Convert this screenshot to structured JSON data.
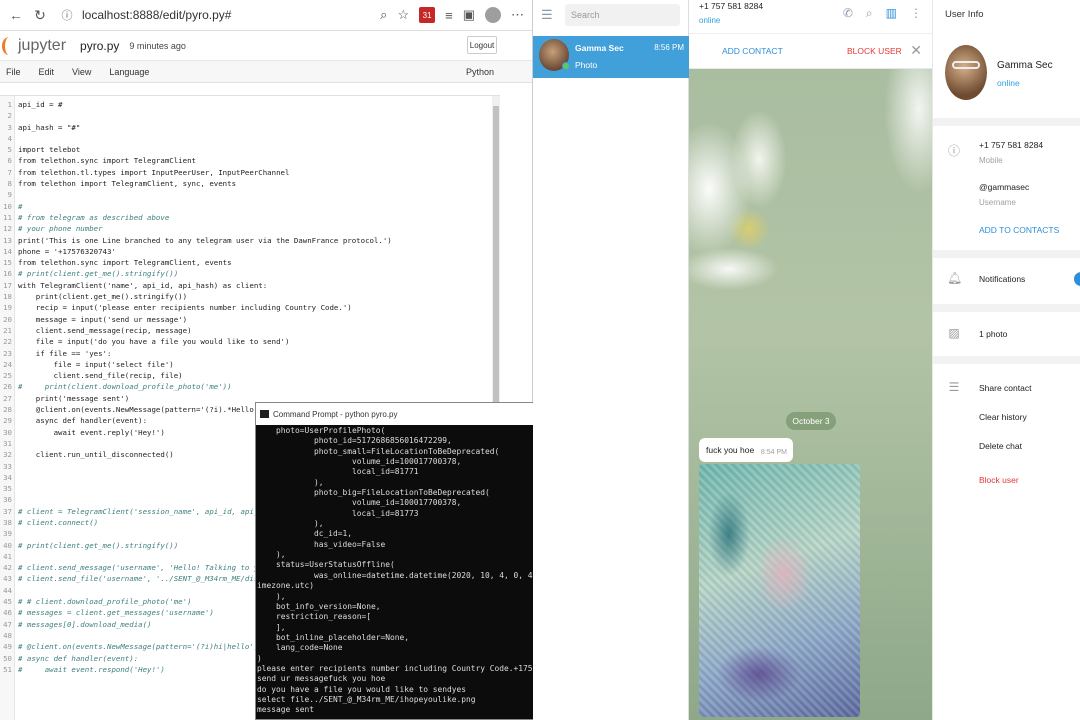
{
  "browser": {
    "url": "localhost:8888/edit/pyro.py#",
    "extension_badge": "31"
  },
  "jupyter": {
    "logo": "jupyter",
    "filename": "pyro.py",
    "saved": "9 minutes ago",
    "logout": "Logout",
    "menu": [
      "File",
      "Edit",
      "View",
      "Language"
    ],
    "kernel": "Python"
  },
  "code_lines": [
    {
      "n": "1",
      "t": "api_id = #"
    },
    {
      "n": "2",
      "t": ""
    },
    {
      "n": "3",
      "t": "api_hash = \"#\""
    },
    {
      "n": "4",
      "t": ""
    },
    {
      "n": "5",
      "t": "import telebot"
    },
    {
      "n": "6",
      "t": "from telethon.sync import TelegramClient"
    },
    {
      "n": "7",
      "t": "from telethon.tl.types import InputPeerUser, InputPeerChannel"
    },
    {
      "n": "8",
      "t": "from telethon import TelegramClient, sync, events"
    },
    {
      "n": "9",
      "t": ""
    },
    {
      "n": "10",
      "t": "#"
    },
    {
      "n": "11",
      "t": "# from telegram as described above"
    },
    {
      "n": "12",
      "t": "# your phone number"
    },
    {
      "n": "13",
      "t": "print('This is one Line branched to any telegram user via the DawnFrance protocol.')"
    },
    {
      "n": "14",
      "t": "phone = '+17576320743'"
    },
    {
      "n": "15",
      "t": "from telethon.sync import TelegramClient, events"
    },
    {
      "n": "16",
      "t": "# print(client.get_me().stringify())"
    },
    {
      "n": "17",
      "t": "with TelegramClient('name', api_id, api_hash) as client:"
    },
    {
      "n": "18",
      "t": "    print(client.get_me().stringify())"
    },
    {
      "n": "19",
      "t": "    recip = input('please enter recipients number including Country Code.')"
    },
    {
      "n": "20",
      "t": "    message = input('send ur message')"
    },
    {
      "n": "21",
      "t": "    client.send_message(recip, message)"
    },
    {
      "n": "22",
      "t": "    file = input('do you have a file you would like to send')"
    },
    {
      "n": "23",
      "t": "    if file == 'yes':"
    },
    {
      "n": "24",
      "t": "        file = input('select file')"
    },
    {
      "n": "25",
      "t": "        client.send_file(recip, file)"
    },
    {
      "n": "26",
      "t": "#     print(client.download_profile_photo('me'))"
    },
    {
      "n": "27",
      "t": "    print('message sent')"
    },
    {
      "n": "28",
      "t": "    @client.on(events.NewMessage(pattern='(?i).*Hello'))"
    },
    {
      "n": "29",
      "t": "    async def handler(event):"
    },
    {
      "n": "30",
      "t": "        await event.reply('Hey!')"
    },
    {
      "n": "31",
      "t": ""
    },
    {
      "n": "32",
      "t": "    client.run_until_disconnected()"
    },
    {
      "n": "33",
      "t": ""
    },
    {
      "n": "34",
      "t": ""
    },
    {
      "n": "35",
      "t": ""
    },
    {
      "n": "36",
      "t": ""
    },
    {
      "n": "37",
      "t": "# client = TelegramClient('session_name', api_id, api_hash)"
    },
    {
      "n": "38",
      "t": "# client.connect()"
    },
    {
      "n": "39",
      "t": ""
    },
    {
      "n": "40",
      "t": "# print(client.get_me().stringify())"
    },
    {
      "n": "41",
      "t": ""
    },
    {
      "n": "42",
      "t": "# client.send_message('username', 'Hello! Talking to you f"
    },
    {
      "n": "43",
      "t": "# client.send_file('username', '../SENT_@_M34rm_ME/dis2.pn"
    },
    {
      "n": "44",
      "t": ""
    },
    {
      "n": "45",
      "t": "# # client.download_profile_photo('me')"
    },
    {
      "n": "46",
      "t": "# messages = client.get_messages('username')"
    },
    {
      "n": "47",
      "t": "# messages[0].download_media()"
    },
    {
      "n": "48",
      "t": ""
    },
    {
      "n": "49",
      "t": "# @client.on(events.NewMessage(pattern='(?i)hi|hello'))"
    },
    {
      "n": "50",
      "t": "# async def handler(event):"
    },
    {
      "n": "51",
      "t": "#     await event.respond('Hey!')"
    }
  ],
  "cmd": {
    "title": "Command Prompt - python  pyro.py",
    "lines": [
      "    photo=UserProfilePhoto(",
      "            photo_id=5172686856016472299,",
      "            photo_small=FileLocationToBeDeprecated(",
      "                    volume_id=100017700378,",
      "                    local_id=81771",
      "            ),",
      "            photo_big=FileLocationToBeDeprecated(",
      "                    volume_id=100017700378,",
      "                    local_id=81773",
      "            ),",
      "            dc_id=1,",
      "            has_video=False",
      "    ),",
      "    status=UserStatusOffline(",
      "            was_online=datetime.datetime(2020, 10, 4, 0, 47, 27, tzinfo=datetime.t",
      "imezone.utc)",
      "    ),",
      "    bot_info_version=None,",
      "    restriction_reason=[",
      "    ],",
      "    bot_inline_placeholder=None,",
      "    lang_code=None",
      ")",
      "please enter recipients number including Country Code.+17576320743",
      "send ur messagefuck you hoe",
      "do you have a file you would like to sendyes",
      "select file../SENT_@_M34rm_ME/ihopeyoulike.png",
      "message sent"
    ]
  },
  "telegram": {
    "search_placeholder": "Search",
    "chat": {
      "name": "Gamma Sec",
      "time": "8:56 PM",
      "preview": "Photo"
    },
    "header": {
      "phone": "+1 757 581 8284",
      "status": "online"
    },
    "actions": {
      "add": "ADD CONTACT",
      "block": "BLOCK USER"
    },
    "date": "October 3",
    "message": {
      "text": "fuck you hoe",
      "time": "8:54 PM"
    },
    "info": {
      "title": "User Info",
      "name": "Gamma Sec",
      "status": "online",
      "phone": "+1 757 581 8284",
      "phone_label": "Mobile",
      "username": "@gammasec",
      "username_label": "Username",
      "add_to_contacts": "ADD TO CONTACTS",
      "notifications": "Notifications",
      "photos": "1 photo",
      "share": "Share contact",
      "clear": "Clear history",
      "delete": "Delete chat",
      "block": "Block user"
    }
  }
}
